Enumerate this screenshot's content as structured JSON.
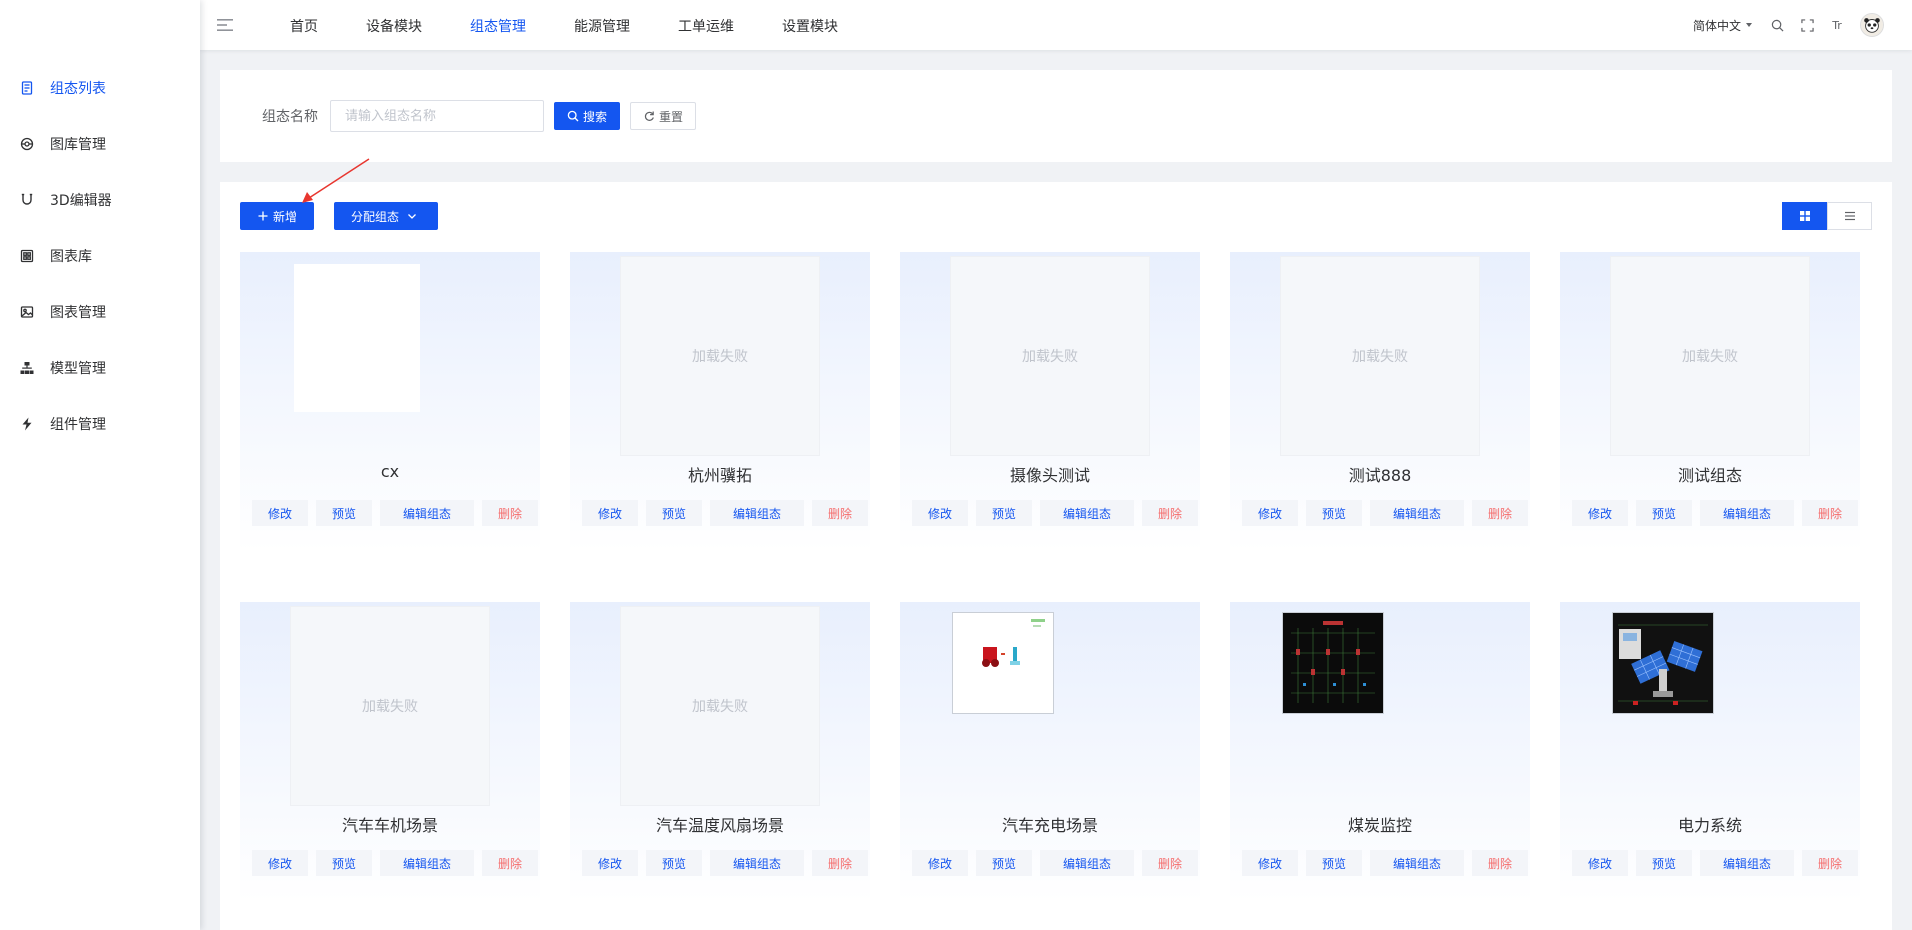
{
  "sidebar": {
    "items": [
      {
        "label": "组态列表",
        "icon": "document-list-icon",
        "active": true
      },
      {
        "label": "图库管理",
        "icon": "gallery-icon",
        "active": false
      },
      {
        "label": "3D编辑器",
        "icon": "magnet-icon",
        "active": false
      },
      {
        "label": "图表库",
        "icon": "chart-library-icon",
        "active": false
      },
      {
        "label": "图表管理",
        "icon": "image-icon",
        "active": false
      },
      {
        "label": "模型管理",
        "icon": "hierarchy-icon",
        "active": false
      },
      {
        "label": "组件管理",
        "icon": "lightning-icon",
        "active": false
      }
    ]
  },
  "header": {
    "nav": [
      {
        "label": "首页",
        "active": false
      },
      {
        "label": "设备模块",
        "active": false
      },
      {
        "label": "组态管理",
        "active": true
      },
      {
        "label": "能源管理",
        "active": false
      },
      {
        "label": "工单运维",
        "active": false
      },
      {
        "label": "设置模块",
        "active": false
      }
    ],
    "language": "简体中文",
    "font_size_icon_text": "Tr"
  },
  "search": {
    "label": "组态名称",
    "placeholder": "请输入组态名称",
    "value": "",
    "search_label": "搜索",
    "reset_label": "重置"
  },
  "toolbar": {
    "add_label": "新增",
    "assign_label": "分配组态"
  },
  "card_actions": {
    "edit": "修改",
    "preview": "预览",
    "design": "编辑组态",
    "delete": "删除"
  },
  "load_failed_text": "加载失败",
  "cards": [
    {
      "title": "cx",
      "thumb": "blank"
    },
    {
      "title": "杭州骥拓",
      "thumb": "failed"
    },
    {
      "title": "摄像头测试",
      "thumb": "failed"
    },
    {
      "title": "测试888",
      "thumb": "failed"
    },
    {
      "title": "测试组态",
      "thumb": "failed"
    },
    {
      "title": "汽车车机场景",
      "thumb": "failed"
    },
    {
      "title": "汽车温度风扇场景",
      "thumb": "failed"
    },
    {
      "title": "汽车充电场景",
      "thumb": "white-diagram"
    },
    {
      "title": "煤炭监控",
      "thumb": "dark-circuit"
    },
    {
      "title": "电力系统",
      "thumb": "dark-power"
    }
  ],
  "colors": {
    "primary": "#1456f0",
    "danger": "#f56c6c",
    "text": "#303133",
    "placeholder": "#c0c4cc",
    "arrow": "#e8362f"
  }
}
